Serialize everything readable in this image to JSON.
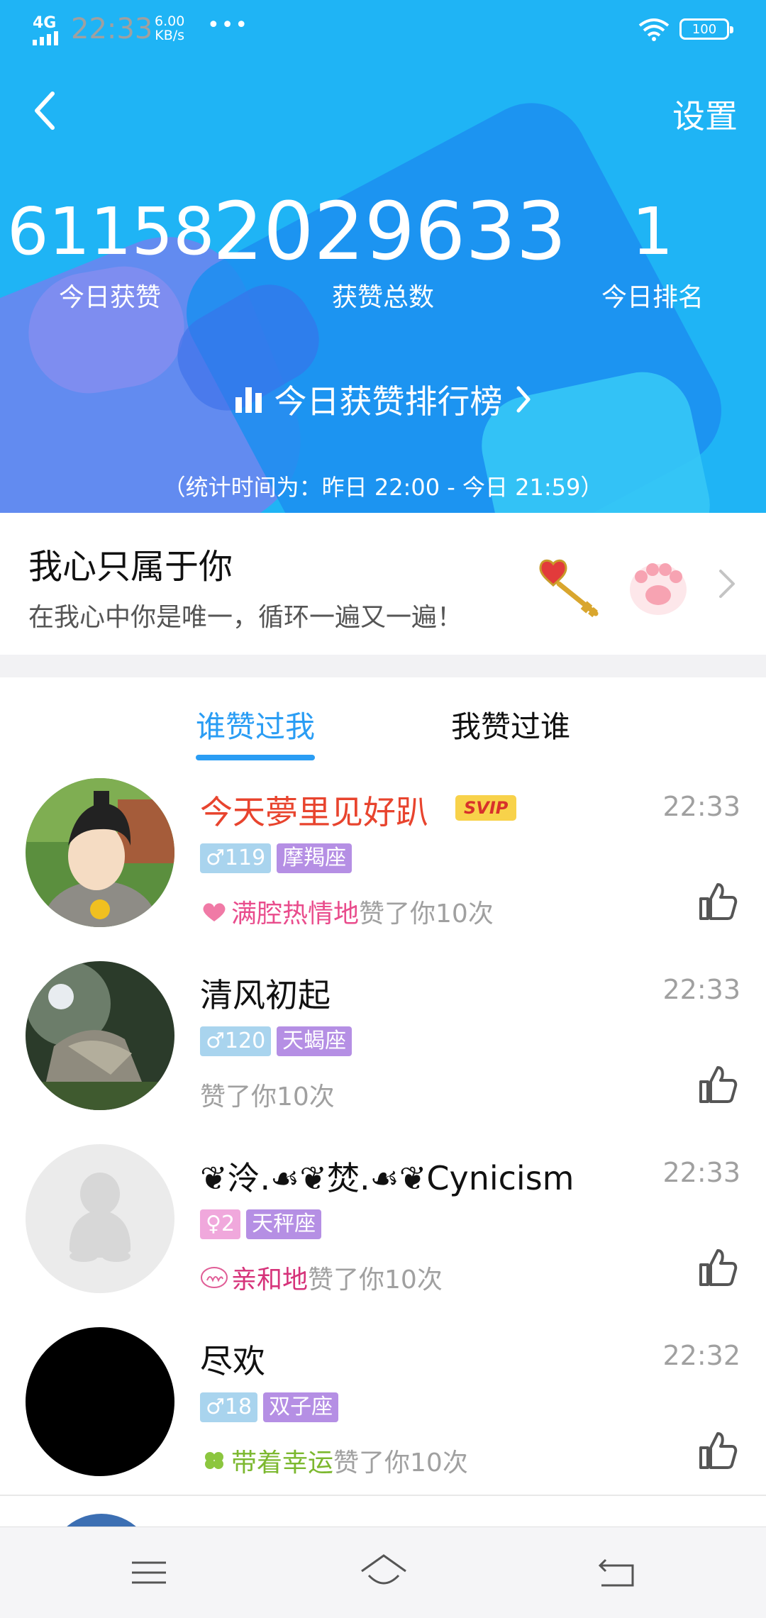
{
  "status_bar": {
    "network": "4G",
    "time": "22:33",
    "speed_value": "6.00",
    "speed_unit": "KB/s",
    "battery": "100"
  },
  "header": {
    "settings_label": "设置",
    "today_likes": "61158",
    "today_likes_label": "今日获赞",
    "total_likes": "2029633",
    "total_likes_label": "获赞总数",
    "today_rank": "1",
    "today_rank_label": "今日排名",
    "leaderboard_link": "今日获赞排行榜",
    "stats_period": "（统计时间为：昨日 22:00 - 今日 21:59）"
  },
  "signature": {
    "title": "我心只属于你",
    "subtitle": "在我心中你是唯一，循环一遍又一遍！",
    "icons": [
      "key-heart-icon",
      "paw-icon",
      "chevron-right-icon"
    ]
  },
  "tabs": [
    {
      "label": "谁赞过我",
      "active": true
    },
    {
      "label": "我赞过谁",
      "active": false
    }
  ],
  "likers": [
    {
      "name": "今天夢里见好趴",
      "vip_badge": "SVIP",
      "time": "22:33",
      "gender_symbol": "♂",
      "age": "119",
      "zodiac": "摩羯座",
      "adjective": "满腔热情地",
      "adjective_color": "#e94c8c",
      "action": "赞了你10次"
    },
    {
      "name": "清风初起",
      "time": "22:33",
      "gender_symbol": "♂",
      "age": "120",
      "zodiac": "天蝎座",
      "adjective": "",
      "action": "赞了你10次"
    },
    {
      "name": "❦泠.☙❦焚.☙❦Cynicism",
      "time": "22:33",
      "gender_symbol": "♀",
      "age": "2",
      "zodiac": "天秤座",
      "adjective": "亲和地",
      "adjective_color": "#d6337a",
      "action": "赞了你10次"
    },
    {
      "name": "尽欢",
      "time": "22:32",
      "gender_symbol": "♂",
      "age": "18",
      "zodiac": "双子座",
      "adjective": "带着幸运",
      "adjective_color": "#7cb82f",
      "action": "赞了你10次"
    }
  ],
  "colors": {
    "header_bg": "#1fb4f5",
    "tab_active": "#2a9df4",
    "vip_name": "#e8442e"
  }
}
